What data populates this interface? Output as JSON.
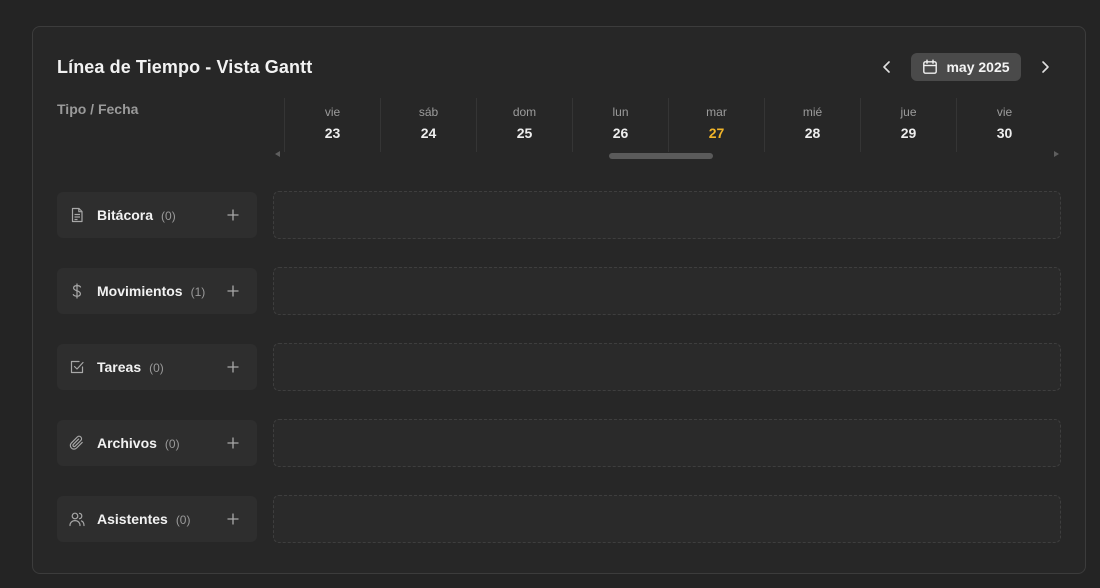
{
  "header": {
    "title": "Línea de Tiempo - Vista Gantt",
    "month_label": "may 2025"
  },
  "column_header": "Tipo / Fecha",
  "days": [
    {
      "name": "vie",
      "num": "23"
    },
    {
      "name": "sáb",
      "num": "24"
    },
    {
      "name": "dom",
      "num": "25"
    },
    {
      "name": "lun",
      "num": "26"
    },
    {
      "name": "mar",
      "num": "27"
    },
    {
      "name": "mié",
      "num": "28"
    },
    {
      "name": "jue",
      "num": "29"
    },
    {
      "name": "vie",
      "num": "30"
    }
  ],
  "rows": [
    {
      "label": "Bitácora",
      "count": "(0)",
      "icon": "file-text-icon"
    },
    {
      "label": "Movimientos",
      "count": "(1)",
      "icon": "dollar-icon"
    },
    {
      "label": "Tareas",
      "count": "(0)",
      "icon": "checkbox-icon"
    },
    {
      "label": "Archivos",
      "count": "(0)",
      "icon": "paperclip-icon"
    },
    {
      "label": "Asistentes",
      "count": "(0)",
      "icon": "users-icon"
    }
  ],
  "colors": {
    "today": "#f0b429",
    "panel": "#272727",
    "background": "#242424"
  }
}
